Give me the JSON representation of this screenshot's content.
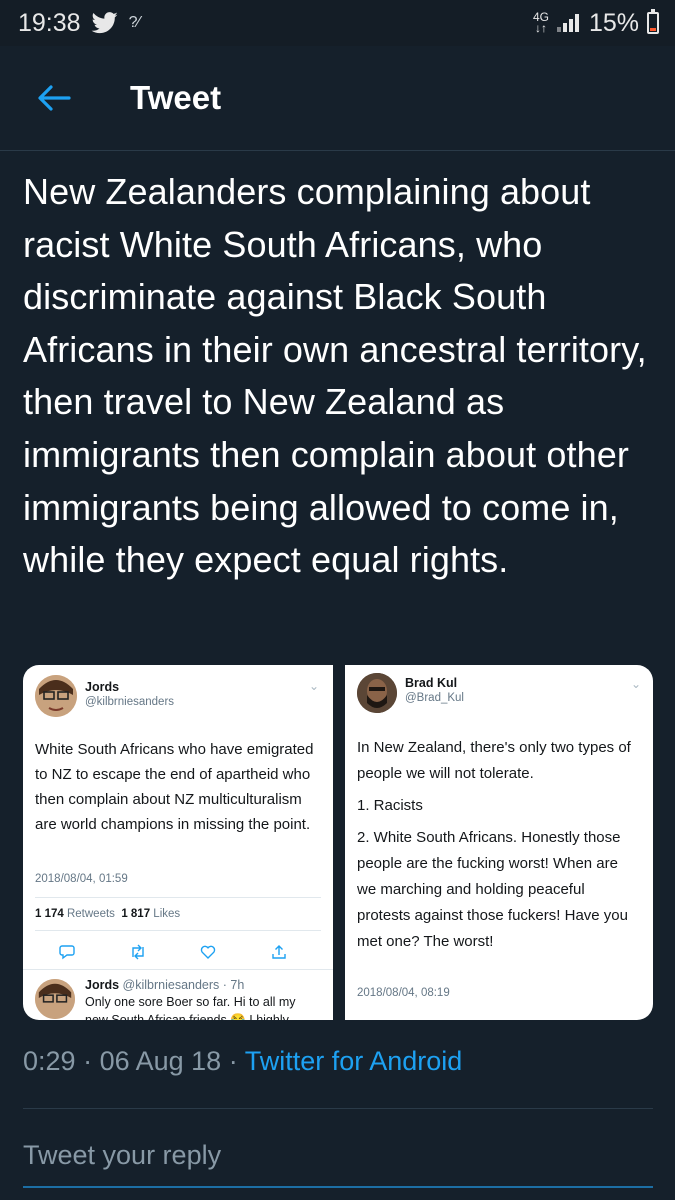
{
  "status_bar": {
    "time": "19:38",
    "network": "4G",
    "battery_percent": "15%",
    "battery_level": 0.15,
    "icons": [
      "twitter-icon",
      "signal-unknown-icon",
      "signal-bars-icon",
      "battery-icon"
    ]
  },
  "header": {
    "back_icon": "arrow-left-icon",
    "title": "Tweet"
  },
  "tweet": {
    "text": "New Zealanders complaining about racist White South Africans, who discriminate against Black South Africans in their own ancestral territory, then travel to New Zealand as immigrants then complain about other immigrants being allowed to come in, while they expect equal rights.",
    "time": "0:29",
    "date": "06 Aug 18",
    "source": "Twitter for Android"
  },
  "media_left": {
    "name": "Jords",
    "handle": "@kilbrniesanders",
    "text": "White South Africans who have emigrated to NZ to escape the end of apartheid who then complain about NZ multiculturalism are world champions in missing the point.",
    "date": "2018/08/04, 01:59",
    "retweets_count": "1 174",
    "retweets_label": "Retweets",
    "likes_count": "1 817",
    "likes_label": "Likes",
    "reply_name": "Jords",
    "reply_handle_time": "@kilbrniesanders · 7h",
    "reply_text": "Only one sore Boer so far. Hi to all my",
    "reply_text_2": "new South African friends 😂 I highly"
  },
  "media_right": {
    "name": "Brad Kul",
    "handle": "@Brad_Kul",
    "text_1": "In New Zealand, there's only two types of people we will not tolerate.",
    "text_2": "1. Racists",
    "text_3": "2. White South Africans. Honestly those people are the fucking worst! When are we marching and holding peaceful protests against those fuckers! Have you met one? The worst!",
    "date": "2018/08/04, 08:19"
  },
  "reply": {
    "placeholder": "Tweet your reply"
  },
  "colors": {
    "background": "#15202b",
    "accent": "#1da1f2",
    "muted": "#8899a6"
  }
}
